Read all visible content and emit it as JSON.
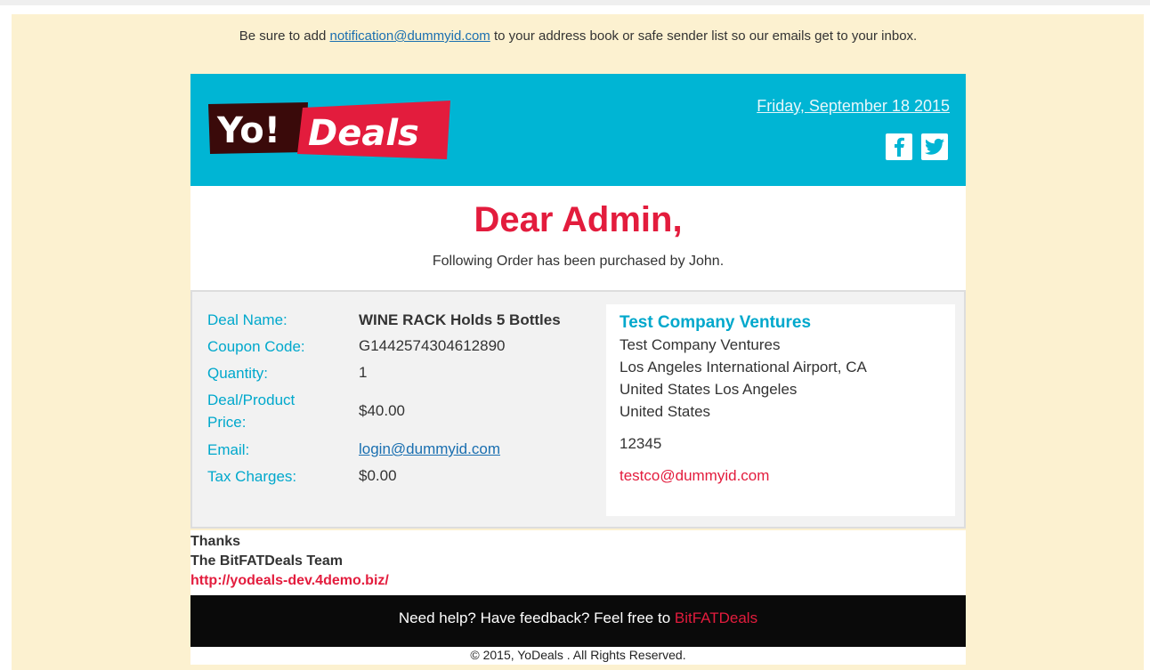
{
  "preheader": {
    "text_before": "Be sure to add ",
    "email_link": "notification@dummyid.com",
    "text_after": " to your address book or safe sender list so our emails get to your inbox."
  },
  "header": {
    "logo_yo": "Yo!",
    "logo_deals": "Deals",
    "date": "Friday, September 18 2015",
    "social": [
      "facebook-icon",
      "twitter-icon"
    ],
    "colors": {
      "header_bg": "#00b5d4",
      "brand_red": "#e31c3d"
    }
  },
  "greeting": {
    "title": "Dear Admin,",
    "subtitle": "Following Order has been purchased by John."
  },
  "order": {
    "rows": [
      {
        "label": "Deal Name:",
        "value": "WINE RACK Holds 5 Bottles"
      },
      {
        "label": "Coupon Code:",
        "value": "G1442574304612890"
      },
      {
        "label": "Quantity:",
        "value": "1"
      },
      {
        "label": "Deal/Product Price:",
        "value": "$40.00"
      },
      {
        "label": "Email:",
        "value": "login@dummyid.com"
      },
      {
        "label": "Tax Charges:",
        "value": "$0.00"
      }
    ]
  },
  "company": {
    "heading": "Test Company Ventures",
    "name": "Test Company Ventures",
    "address1": "Los Angeles International Airport, CA",
    "address2": "United States Los Angeles",
    "address3": "United States",
    "zip": "12345",
    "email": "testco@dummyid.com"
  },
  "signoff": {
    "thanks": "Thanks",
    "team": "The BitFATDeals Team",
    "url": "http://yodeals-dev.4demo.biz/"
  },
  "footer": {
    "text": "Need help? Have feedback? Feel free to ",
    "brand": "BitFATDeals",
    "copyright": "© 2015, YoDeals . All Rights Reserved."
  }
}
